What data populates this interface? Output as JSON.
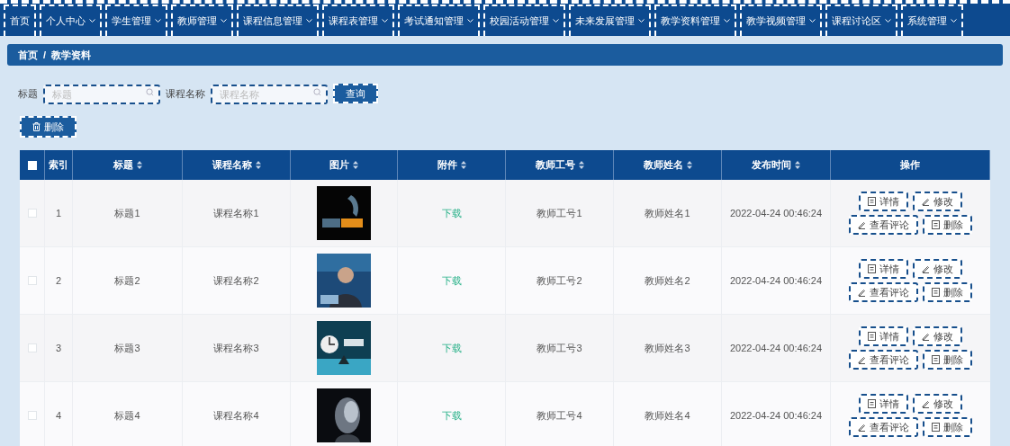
{
  "nav": [
    {
      "label": "首页",
      "has_menu": false
    },
    {
      "label": "个人中心",
      "has_menu": true
    },
    {
      "label": "学生管理",
      "has_menu": true
    },
    {
      "label": "教师管理",
      "has_menu": true
    },
    {
      "label": "课程信息管理",
      "has_menu": true
    },
    {
      "label": "课程表管理",
      "has_menu": true
    },
    {
      "label": "考试通知管理",
      "has_menu": true
    },
    {
      "label": "校园活动管理",
      "has_menu": true
    },
    {
      "label": "未来发展管理",
      "has_menu": true
    },
    {
      "label": "教学资料管理",
      "has_menu": true
    },
    {
      "label": "教学视频管理",
      "has_menu": true
    },
    {
      "label": "课程讨论区",
      "has_menu": true
    },
    {
      "label": "系统管理",
      "has_menu": true
    }
  ],
  "breadcrumb": [
    "首页",
    "教学资料"
  ],
  "breadcrumb_separator": "/",
  "search": {
    "fields": [
      {
        "label": "标题",
        "placeholder": "标题"
      },
      {
        "label": "课程名称",
        "placeholder": "课程名称"
      }
    ],
    "button": "查询"
  },
  "delete_button": "删除",
  "table": {
    "select_all_checked": false,
    "columns": [
      {
        "label": "索引",
        "sortable": false
      },
      {
        "label": "标题",
        "sortable": true
      },
      {
        "label": "课程名称",
        "sortable": true
      },
      {
        "label": "图片",
        "sortable": true
      },
      {
        "label": "附件",
        "sortable": true
      },
      {
        "label": "教师工号",
        "sortable": true
      },
      {
        "label": "教师姓名",
        "sortable": true
      },
      {
        "label": "发布时间",
        "sortable": true
      },
      {
        "label": "操作",
        "sortable": false
      }
    ],
    "rows": [
      {
        "checked": false,
        "index": "1",
        "title": "标题1",
        "course": "课程名称1",
        "attachment": "下载",
        "teacher_no": "教师工号1",
        "teacher_name": "教师姓名1",
        "time": "2022-04-24 00:46:24",
        "actions": [
          "详情",
          "修改",
          "查看评论",
          "删除"
        ]
      },
      {
        "checked": false,
        "index": "2",
        "title": "标题2",
        "course": "课程名称2",
        "attachment": "下载",
        "teacher_no": "教师工号2",
        "teacher_name": "教师姓名2",
        "time": "2022-04-24 00:46:24",
        "actions": [
          "详情",
          "修改",
          "查看评论",
          "删除"
        ]
      },
      {
        "checked": false,
        "index": "3",
        "title": "标题3",
        "course": "课程名称3",
        "attachment": "下载",
        "teacher_no": "教师工号3",
        "teacher_name": "教师姓名3",
        "time": "2022-04-24 00:46:24",
        "actions": [
          "详情",
          "修改",
          "查看评论",
          "删除"
        ]
      },
      {
        "checked": false,
        "index": "4",
        "title": "标题4",
        "course": "课程名称4",
        "attachment": "下载",
        "teacher_no": "教师工号4",
        "teacher_name": "教师姓名4",
        "time": "2022-04-24 00:46:24",
        "actions": [
          "详情",
          "修改",
          "查看评论",
          "删除"
        ]
      }
    ]
  }
}
